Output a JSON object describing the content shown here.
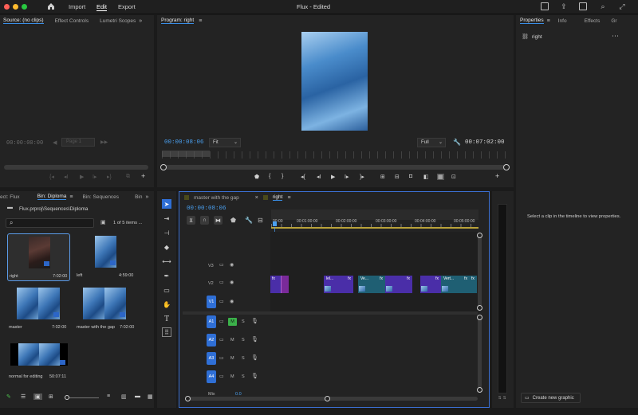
{
  "titlebar": {
    "title": "Flux - Edited",
    "nav": [
      "Import",
      "Edit",
      "Export"
    ],
    "active_nav": "Edit"
  },
  "source_panel": {
    "tabs": [
      "Source: (no clips)",
      "Effect Controls",
      "Lumetri Scopes"
    ],
    "timecode": "00:00:00:00",
    "page_label": "Page 1"
  },
  "program_panel": {
    "tab": "Program: right",
    "timecode": "00:00:08:06",
    "fit": "Fit",
    "resolution": "Full",
    "duration": "00:07:02:00"
  },
  "properties_panel": {
    "tabs": [
      "Properties",
      "Info",
      "Effects",
      "Gr"
    ],
    "clip_name": "right",
    "message": "Select a clip in the timeline to view properties.",
    "button": "Create new graphic"
  },
  "project_panel": {
    "tabs": [
      "ect: Flux",
      "Bin: Diploma",
      "Bin: Sequences",
      "Bin"
    ],
    "path": "Flux.prproj\\Sequences\\Diploma",
    "item_count": "1 of 5 items ...",
    "items": [
      {
        "name": "right",
        "duration": "7:02:00"
      },
      {
        "name": "left",
        "duration": "4:59:00"
      },
      {
        "name": "master",
        "duration": "7:02:00"
      },
      {
        "name": "master with the gap",
        "duration": "7:02:00"
      },
      {
        "name": "normal for editing",
        "duration": "50:07:11"
      }
    ]
  },
  "timeline": {
    "tabs": [
      "master with the gap",
      "right"
    ],
    "timecode": "00:00:08:06",
    "ruler": [
      "00:00",
      "00:01:00:00",
      "00:02:00:00",
      "00:03:00:00",
      "00:04:00:00",
      "00:05:00:00"
    ],
    "video_tracks": [
      "V3",
      "V2",
      "V1"
    ],
    "audio_tracks": [
      "A1",
      "A2",
      "A3",
      "A4"
    ],
    "mix_label": "Mix",
    "mix_value": "0.0",
    "clips": [
      {
        "label": "fx",
        "name": ""
      },
      {
        "label": "fx",
        "name": "lel..."
      },
      {
        "label": "fx",
        "name": "Ve..."
      },
      {
        "label": "fx",
        "name": ""
      },
      {
        "label": "fx",
        "name": ""
      },
      {
        "label": "fx",
        "name": "Vert..."
      },
      {
        "label": "fx",
        "name": ""
      }
    ],
    "ms_m": "M",
    "ms_s": "S"
  },
  "meter": {
    "labels": [
      "S",
      "S"
    ]
  },
  "colors": {
    "accent": "#3a8ee6",
    "clip_purple": "#4a2ea8",
    "clip_teal": "#1f5f73",
    "track_target": "#2f6fd6",
    "timeline_border": "#3b6fd1"
  }
}
